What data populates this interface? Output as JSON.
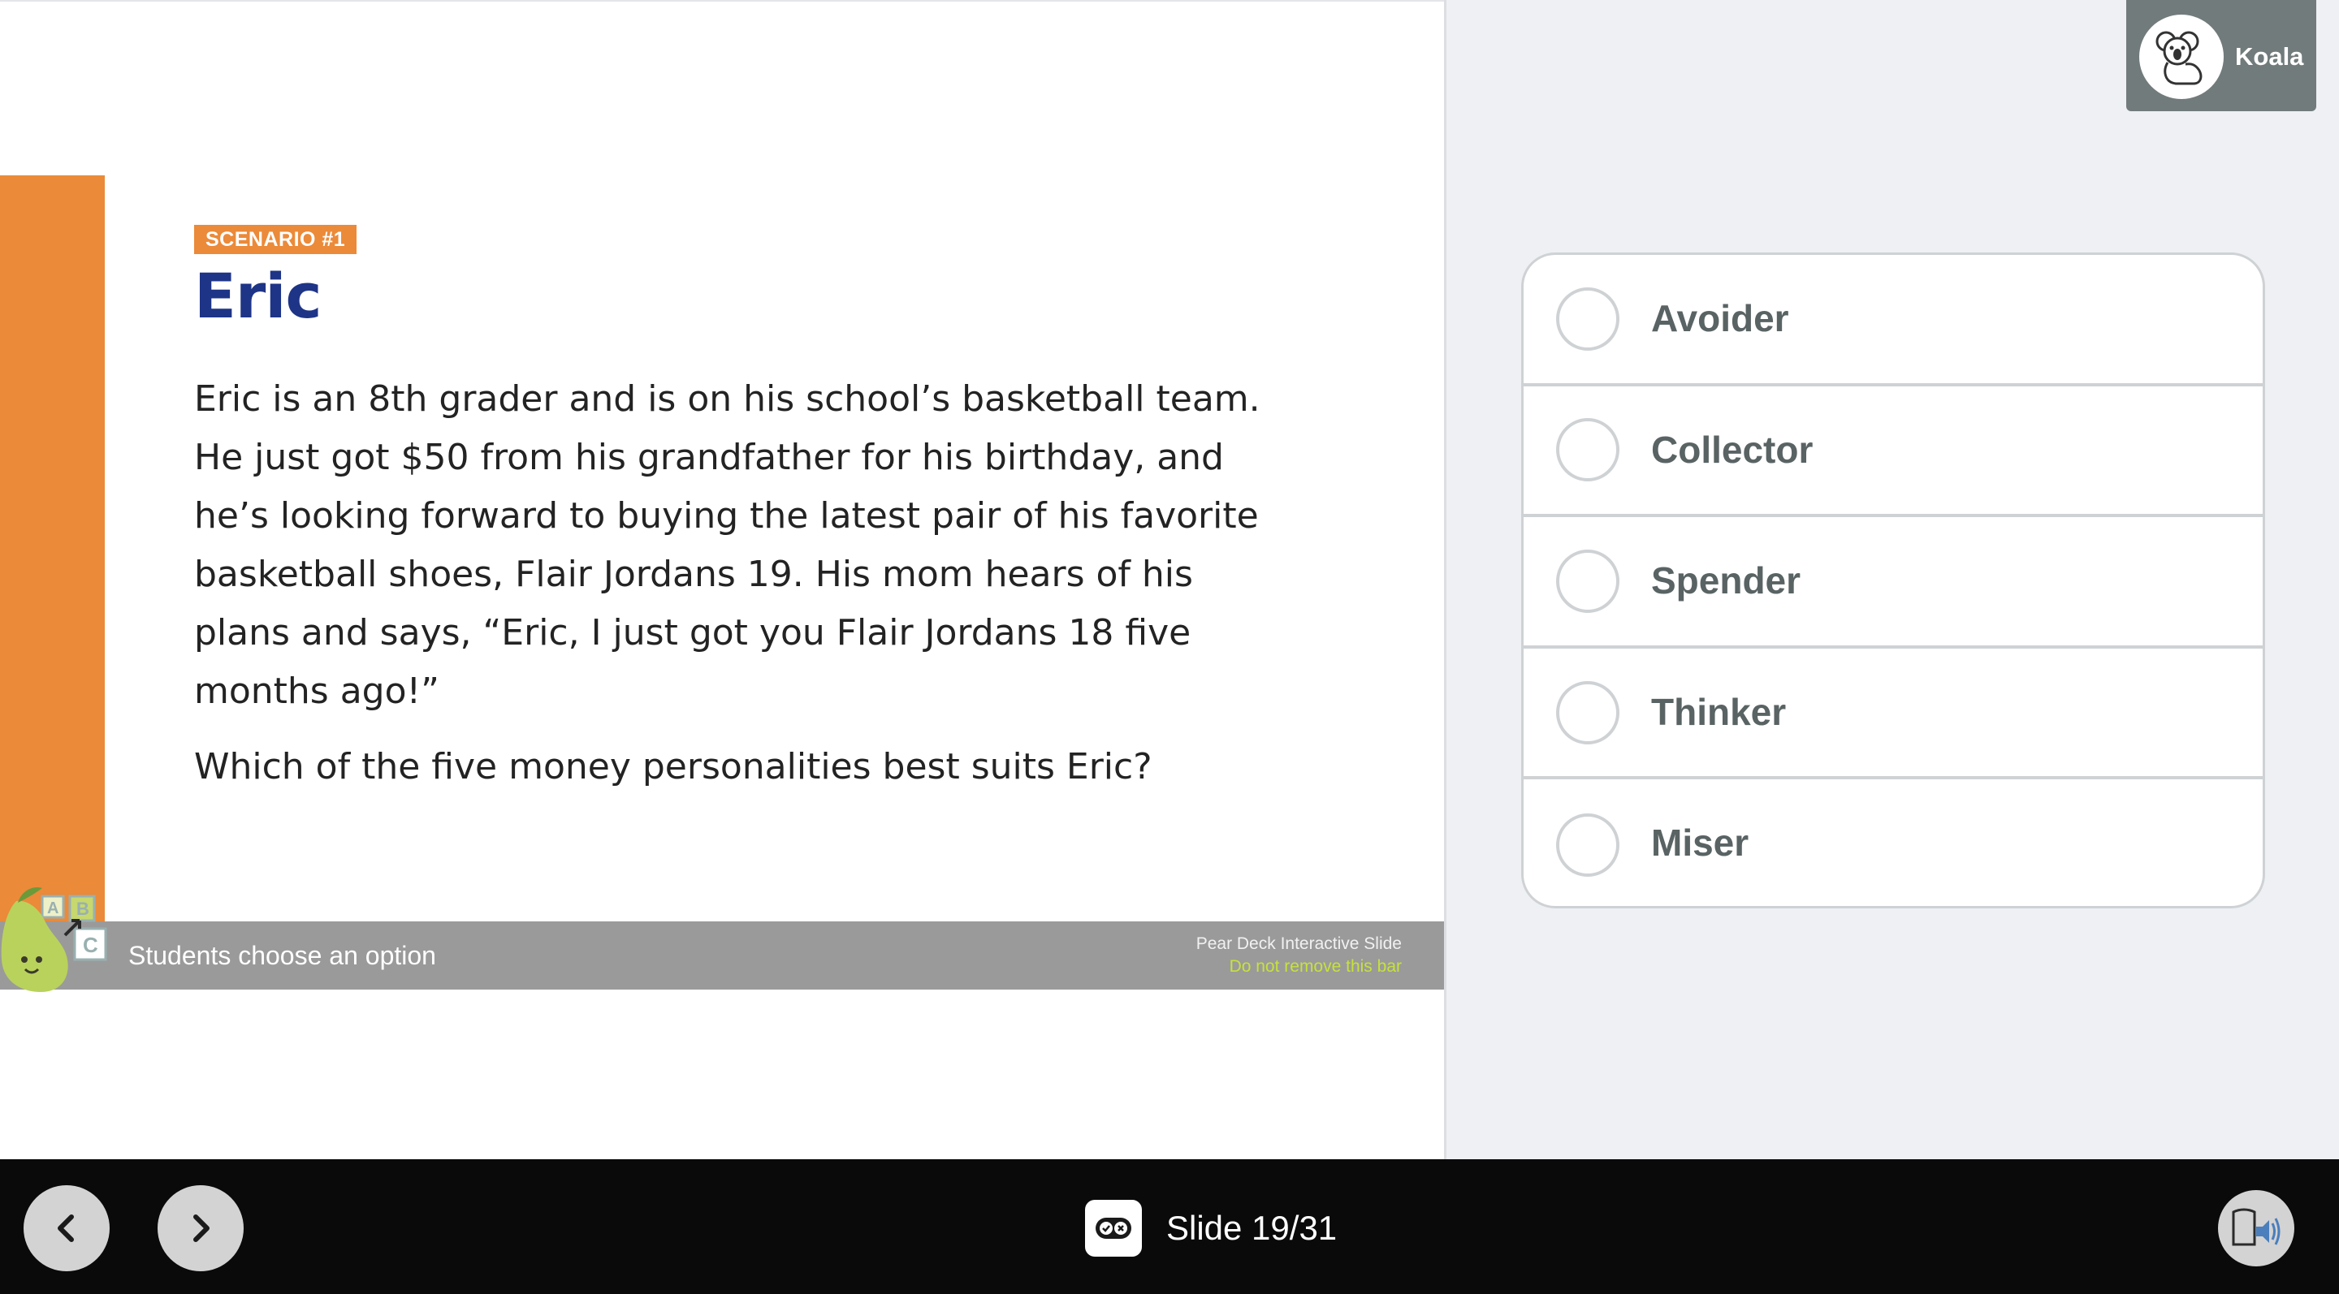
{
  "slide": {
    "badge": "SCENARIO #1",
    "title": "Eric",
    "body": "Eric is an 8th grader and is on his school’s basketball team. He just got $50 from his grandfather for his birthday, and he’s looking forward to buying the latest pair of his favorite basketball shoes, Flair Jordans 19. His mom hears of his plans and says, “Eric, I just got you Flair Jordans 18 five months ago!”",
    "question": "Which of the five money personalities best suits Eric?",
    "pd_bar": {
      "label": "Students choose an option",
      "note_line1": "Pear Deck Interactive Slide",
      "note_line2": "Do not remove this bar"
    },
    "colors": {
      "accent": "#eb8a39",
      "title": "#1e3487"
    }
  },
  "user": {
    "name": "Koala",
    "avatar_icon": "koala-icon"
  },
  "options": [
    {
      "label": "Avoider",
      "selected": false
    },
    {
      "label": "Collector",
      "selected": false
    },
    {
      "label": "Spender",
      "selected": false
    },
    {
      "label": "Thinker",
      "selected": false
    },
    {
      "label": "Miser",
      "selected": false
    }
  ],
  "bottom_bar": {
    "prev_icon": "chevron-left-icon",
    "next_icon": "chevron-right-icon",
    "slide_label": "Slide 19/31",
    "audio_icon": "read-aloud-icon"
  }
}
